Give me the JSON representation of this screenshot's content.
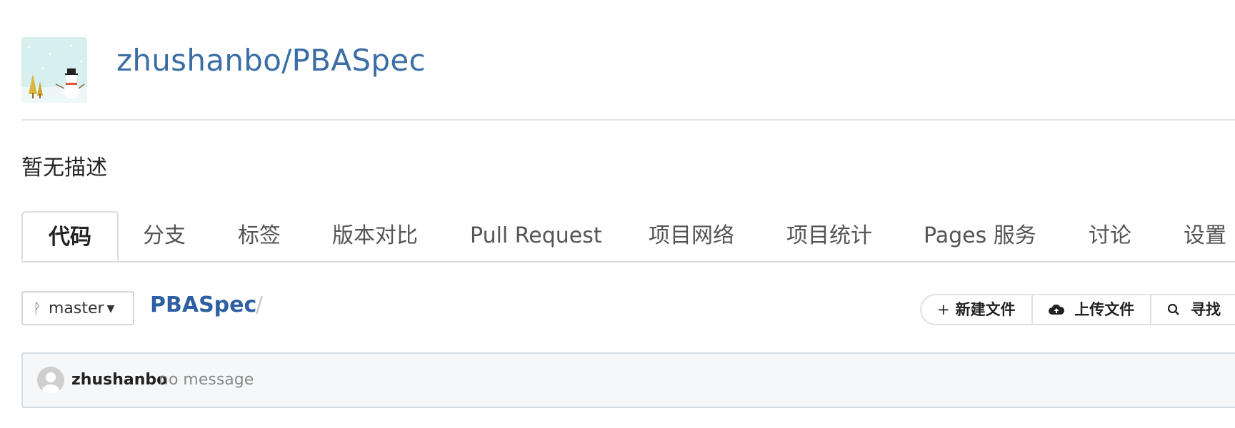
{
  "repo": {
    "owner": "zhushanbo",
    "separator": "/",
    "name": "PBASpec",
    "description": "暂无描述"
  },
  "tabs": [
    {
      "label": "代码",
      "active": true
    },
    {
      "label": "分支"
    },
    {
      "label": "标签"
    },
    {
      "label": "版本对比"
    },
    {
      "label": "Pull Request"
    },
    {
      "label": "项目网络"
    },
    {
      "label": "项目统计"
    },
    {
      "label": "Pages 服务"
    },
    {
      "label": "讨论"
    },
    {
      "label": "设置"
    }
  ],
  "toolbar": {
    "branch": "master",
    "breadcrumb_repo": "PBASpec",
    "breadcrumb_sep": "/",
    "new_file_icon": "+",
    "new_file_label": "新建文件",
    "upload_label": "上传文件",
    "find_label": "寻找"
  },
  "commit": {
    "author": "zhushanbo",
    "message": "no message"
  },
  "colors": {
    "link": "#3b6ea5",
    "commit_bg": "#f5f7f9"
  }
}
